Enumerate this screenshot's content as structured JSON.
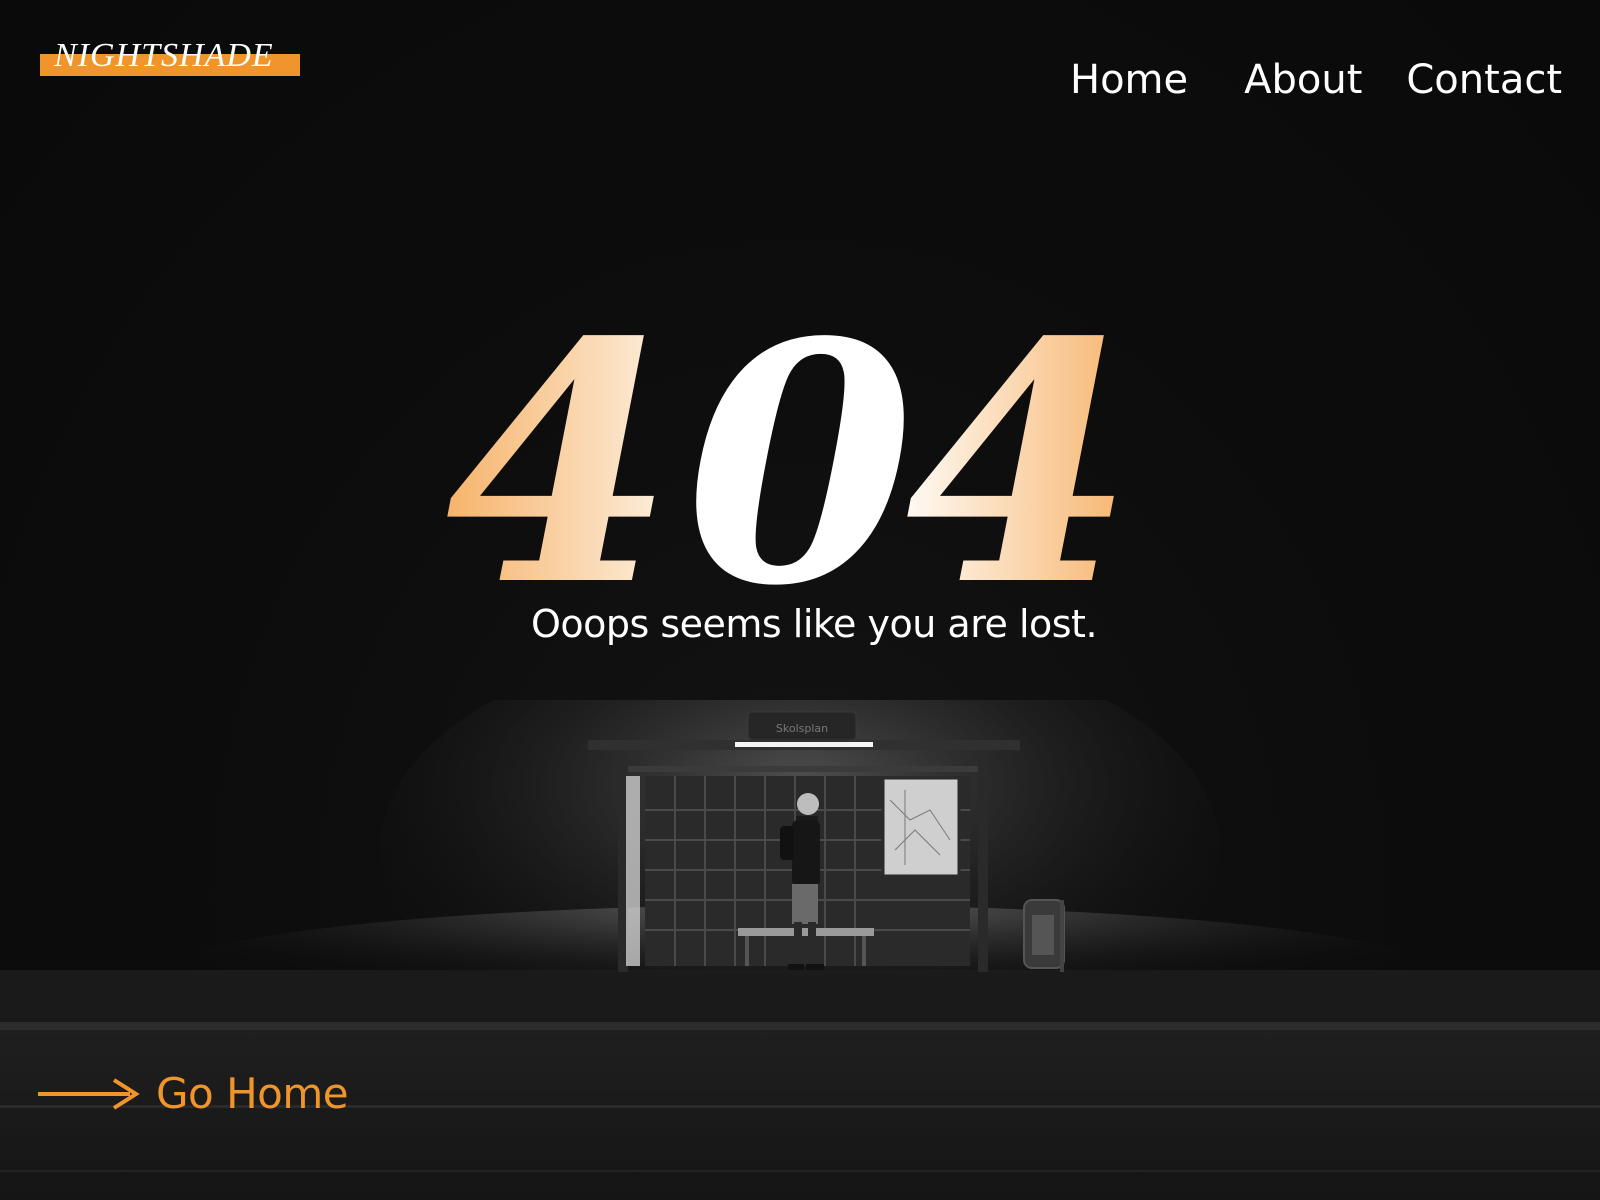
{
  "brand": {
    "name": "NIGHTSHADE",
    "accent_color": "#f0952b"
  },
  "nav": {
    "items": [
      {
        "label": "Home"
      },
      {
        "label": "About"
      },
      {
        "label": "Contact"
      }
    ]
  },
  "error": {
    "code_digits": [
      "4",
      "0",
      "4"
    ],
    "message": "Ooops seems like you are lost."
  },
  "scene": {
    "sign_text": "Skolsplan"
  },
  "cta": {
    "label": "Go Home",
    "icon": "arrow-right-icon"
  }
}
